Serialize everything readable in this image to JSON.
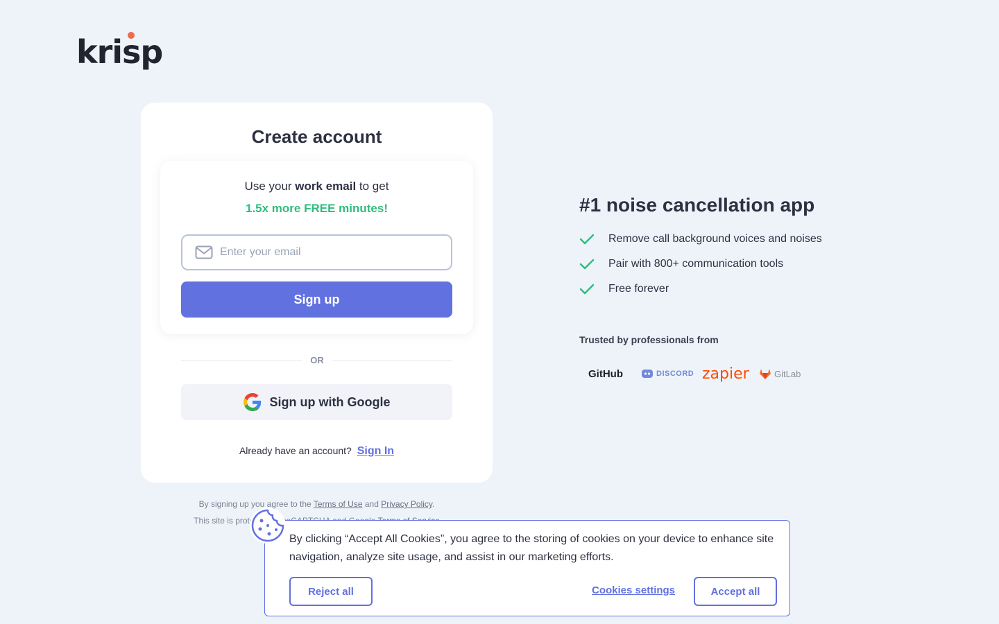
{
  "brand": {
    "logo_text": "krisp",
    "accent_color": "#f06a4c"
  },
  "signup": {
    "title": "Create account",
    "promo_prefix": "Use your ",
    "promo_bold": "work email",
    "promo_suffix": " to get",
    "promo_highlight": "1.5x more FREE minutes!",
    "email_placeholder": "Enter your email",
    "email_value": "",
    "signup_label": "Sign up",
    "or_label": "OR",
    "google_label": "Sign up with Google",
    "already_text": "Already have an account?",
    "signin_label": "Sign In"
  },
  "legal": {
    "line1_prefix": "By signing up you agree to the ",
    "terms_label": "Terms of Use",
    "and_label": " and ",
    "privacy_label": "Privacy Policy",
    "line1_suffix": ".",
    "line2_prefix": "This site is protected by reCAPTCHA and Google ",
    "google_terms_label": "Terms of Service"
  },
  "marketing": {
    "title": "#1 noise cancellation app",
    "features": [
      "Remove call background voices and noises",
      "Pair with 800+ communication tools",
      "Free forever"
    ],
    "trusted_label": "Trusted by professionals from",
    "brands": [
      "GitHub",
      "DISCORD",
      "zapier",
      "GitLab"
    ]
  },
  "cookies": {
    "text": "By clicking “Accept All Cookies”, you agree to the storing of cookies on your device to enhance site navigation, analyze site usage, and assist in our marketing efforts.",
    "reject_label": "Reject all",
    "settings_label": "Cookies settings",
    "accept_label": "Accept all"
  },
  "colors": {
    "primary": "#6171e0",
    "success": "#2fbd7d",
    "background": "#eef3fa"
  }
}
